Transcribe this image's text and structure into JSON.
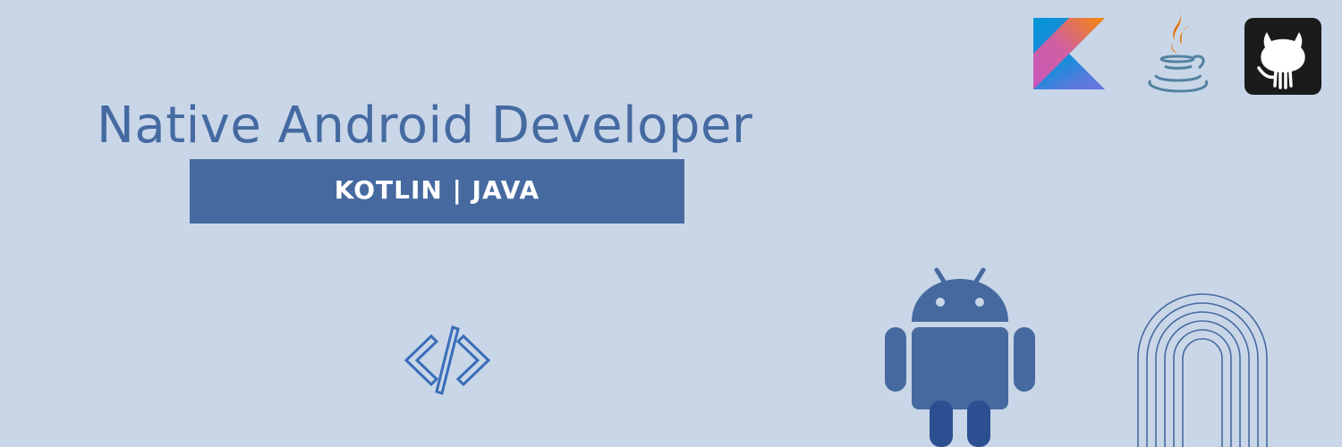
{
  "title": "Native Android Developer",
  "subtitle": "KOTLIN | JAVA",
  "icons": {
    "kotlin": "kotlin-logo-icon",
    "java": "java-logo-icon",
    "github": "github-logo-icon",
    "code": "code-brackets-icon",
    "android": "android-robot-icon",
    "arch": "concentric-arch-decoration"
  },
  "colors": {
    "background": "#c8d6e8",
    "accent": "#456aa1",
    "subtitle_text": "#ffffff",
    "github_tile": "#1b1b1b",
    "java_orange": "#e76f00",
    "java_blue": "#5382a1"
  }
}
